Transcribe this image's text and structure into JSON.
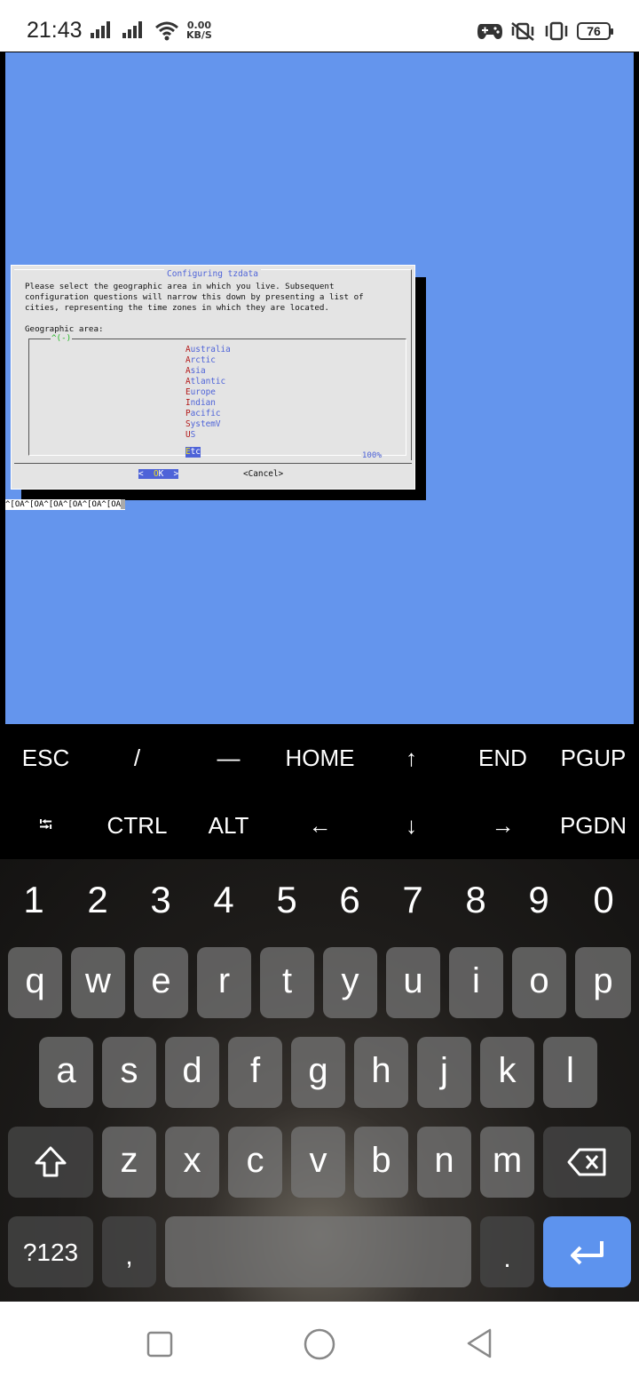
{
  "status_bar": {
    "time": "21:43",
    "net_speed_value": "0.00",
    "net_speed_unit": "KB/S",
    "battery": "76",
    "icons": [
      "signal-icon",
      "signal-icon",
      "wifi-icon",
      "game-mode-icon",
      "vibrate-off-icon",
      "vibrate-icon",
      "battery-icon"
    ]
  },
  "terminal": {
    "dialog": {
      "title": "Configuring tzdata",
      "message_lines": [
        "Please select the geographic area in which you live. Subsequent",
        "configuration questions will narrow this down by presenting a list of",
        "cities, representing the time zones in which they are located."
      ],
      "list_label": "Geographic area:",
      "scroll_indicator": "^(-)",
      "areas": [
        {
          "hotkey": "A",
          "rest": "ustralia"
        },
        {
          "hotkey": "A",
          "rest": "rctic"
        },
        {
          "hotkey": "A",
          "rest": "sia"
        },
        {
          "hotkey": "A",
          "rest": "tlantic"
        },
        {
          "hotkey": "E",
          "rest": "urope"
        },
        {
          "hotkey": "I",
          "rest": "ndian"
        },
        {
          "hotkey": "P",
          "rest": "acific"
        },
        {
          "hotkey": "S",
          "rest": "ystemV"
        },
        {
          "hotkey": "U",
          "rest": "S"
        },
        {
          "hotkey": "E",
          "rest": "tc",
          "selected": true
        }
      ],
      "list_percent": "100%",
      "ok_left": "<  ",
      "ok_hotkey": "O",
      "ok_rest": "K  >",
      "cancel_label": "<Cancel>"
    },
    "echo_line": "^[OA^[OA^[OA^[OA^[OA^[OA"
  },
  "extra_keys": {
    "row1": [
      "ESC",
      "/",
      "—",
      "HOME",
      "↑",
      "END",
      "PGUP"
    ],
    "row2": [
      "⭾",
      "CTRL",
      "ALT",
      "←",
      "↓",
      "→",
      "PGDN"
    ]
  },
  "keyboard": {
    "numbers": [
      "1",
      "2",
      "3",
      "4",
      "5",
      "6",
      "7",
      "8",
      "9",
      "0"
    ],
    "row1": [
      "q",
      "w",
      "e",
      "r",
      "t",
      "y",
      "u",
      "i",
      "o",
      "p"
    ],
    "row2": [
      "a",
      "s",
      "d",
      "f",
      "g",
      "h",
      "j",
      "k",
      "l"
    ],
    "row3": [
      "z",
      "x",
      "c",
      "v",
      "b",
      "n",
      "m"
    ],
    "symbols_label": "?123",
    "comma": ",",
    "period": ".",
    "shift_icon": "shift-icon",
    "backspace_icon": "backspace-icon",
    "enter_icon": "enter-icon"
  },
  "nav_bar": {
    "icons": [
      "recents-icon",
      "home-icon",
      "back-icon"
    ]
  }
}
